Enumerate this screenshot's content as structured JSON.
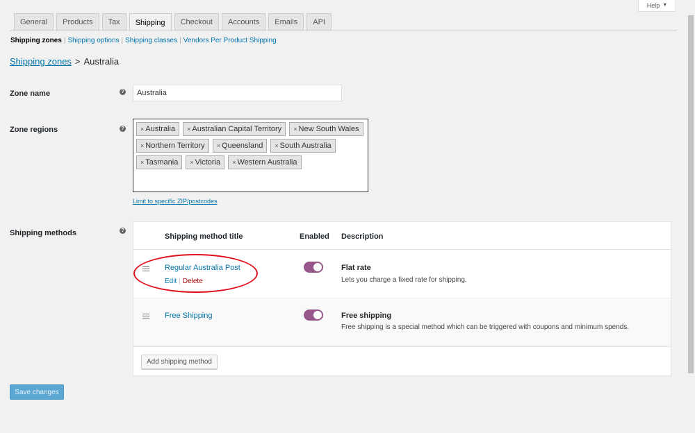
{
  "help": {
    "label": "Help"
  },
  "tabs": [
    {
      "label": "General"
    },
    {
      "label": "Products"
    },
    {
      "label": "Tax"
    },
    {
      "label": "Shipping",
      "active": true
    },
    {
      "label": "Checkout"
    },
    {
      "label": "Accounts"
    },
    {
      "label": "Emails"
    },
    {
      "label": "API"
    }
  ],
  "subnav": {
    "current": "Shipping zones",
    "items": [
      "Shipping options",
      "Shipping classes",
      "Vendors Per Product Shipping"
    ],
    "separator": "|"
  },
  "breadcrumb": {
    "parent": "Shipping zones",
    "separator": ">",
    "current": "Australia"
  },
  "zone_name": {
    "label": "Zone name",
    "value": "Australia"
  },
  "zone_regions": {
    "label": "Zone regions",
    "chips": [
      "Australia",
      "Australian Capital Territory",
      "New South Wales",
      "Northern Territory",
      "Queensland",
      "South Australia",
      "Tasmania",
      "Victoria",
      "Western Australia"
    ],
    "remove_glyph": "×",
    "zip_link": "Limit to specific ZIP/postcodes"
  },
  "help_glyph": "?",
  "shipping_methods": {
    "label": "Shipping methods",
    "headers": {
      "title": "Shipping method title",
      "enabled": "Enabled",
      "description": "Description"
    },
    "rows": [
      {
        "title": "Regular Australia Post",
        "edit": "Edit",
        "delete": "Delete",
        "enabled": true,
        "type": "Flat rate",
        "description": "Lets you charge a fixed rate for shipping."
      },
      {
        "title": "Free Shipping",
        "enabled": true,
        "type": "Free shipping",
        "description": "Free shipping is a special method which can be triggered with coupons and minimum spends."
      }
    ],
    "add_button": "Add shipping method"
  },
  "save_button": "Save changes",
  "colors": {
    "link": "#0073aa",
    "toggle_on": "#96588a",
    "delete": "#a00",
    "annotation": "#e0101a",
    "primary_button": "#5aa7d4"
  }
}
